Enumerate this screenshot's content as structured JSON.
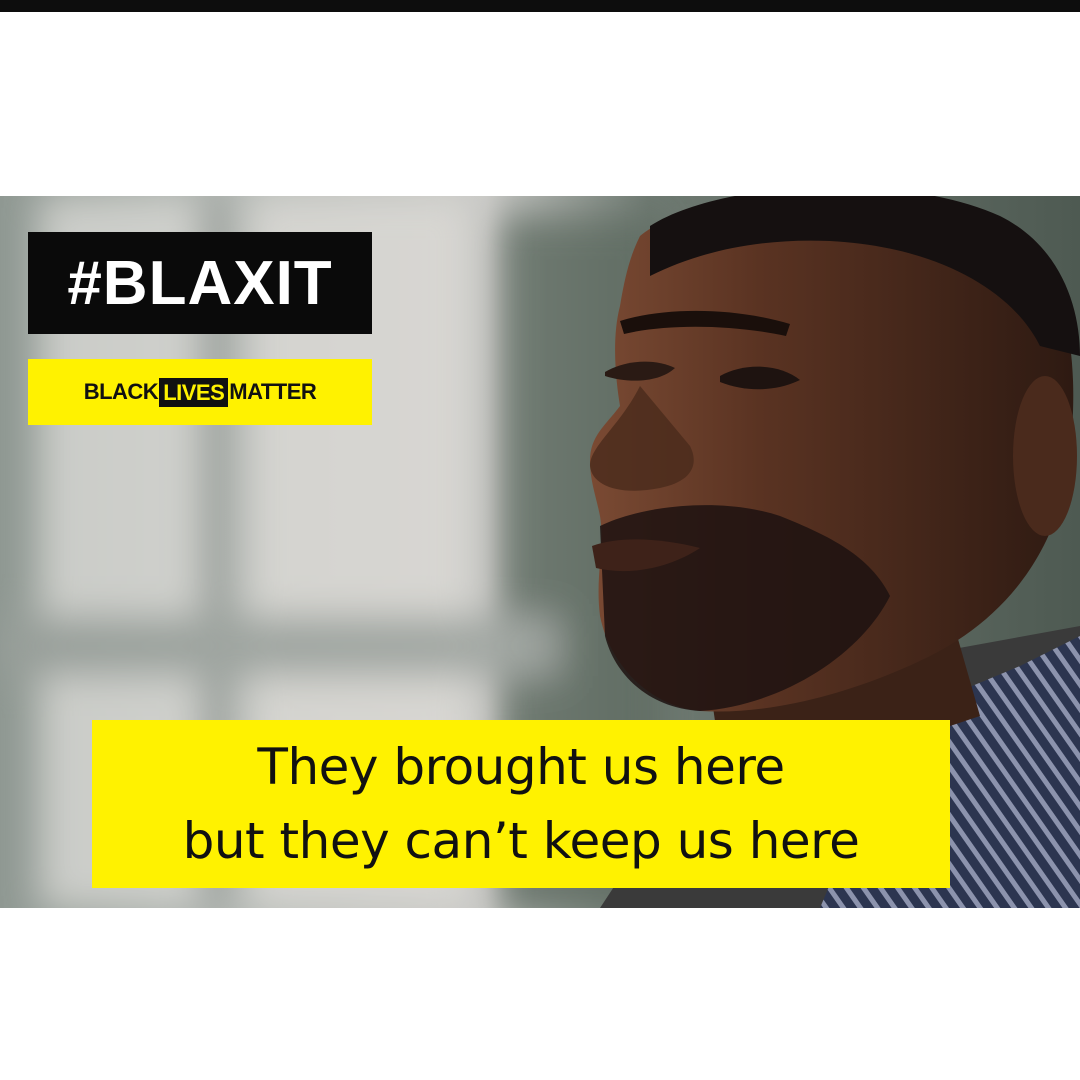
{
  "hashtag": "#BLAXIT",
  "badge": {
    "left": "BLACK",
    "middle": "LIVES",
    "right": "MATTER"
  },
  "caption": {
    "line1": "They brought us here",
    "line2": "but they can’t keep us here"
  },
  "colors": {
    "accent_yellow": "#fff200",
    "badge_black": "#0a0a0a",
    "background": "#ffffff"
  }
}
